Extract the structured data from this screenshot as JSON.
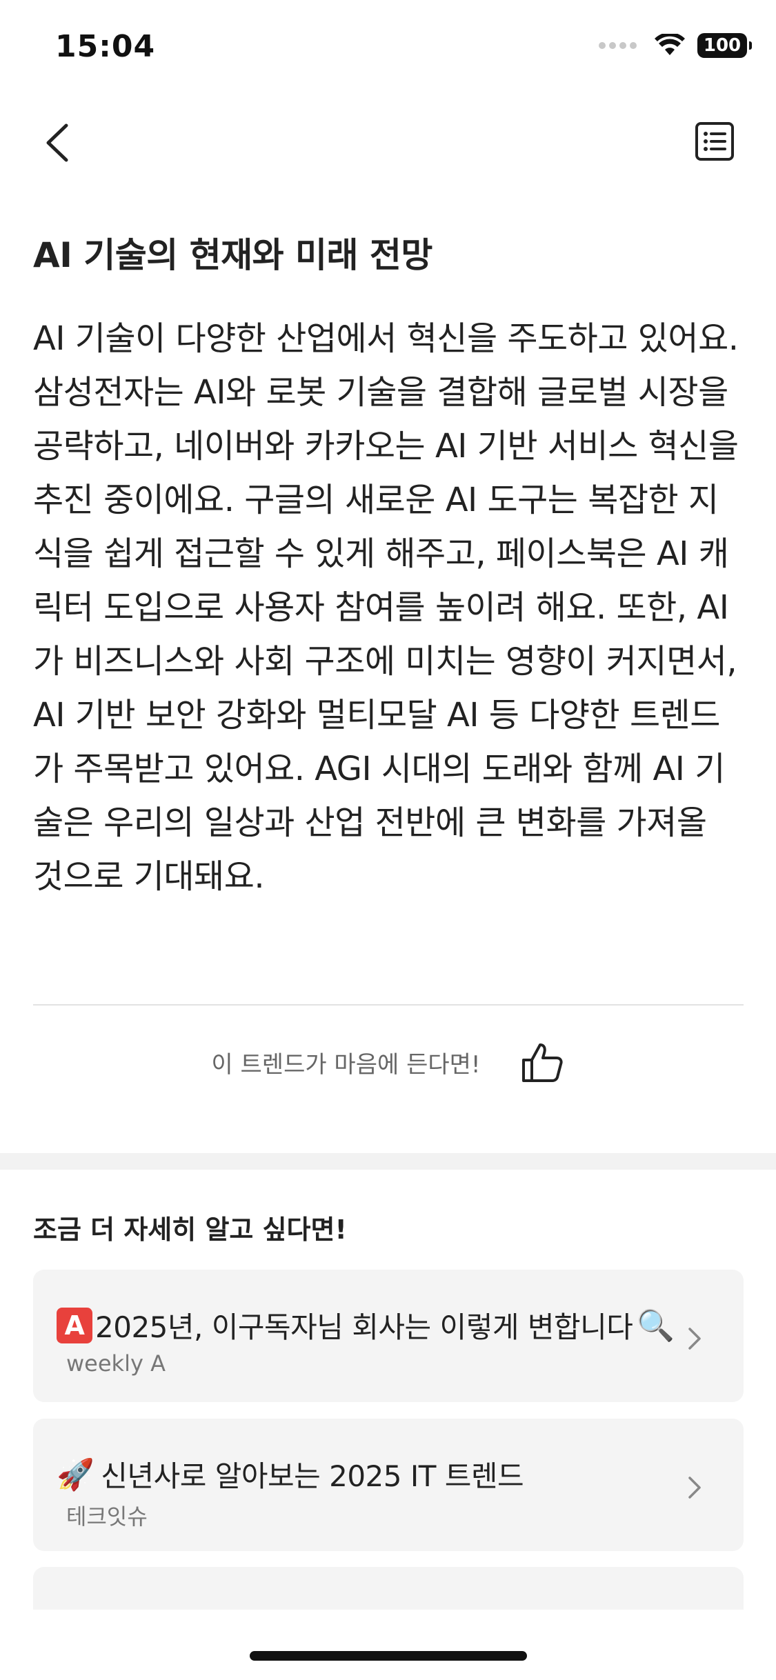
{
  "status_bar": {
    "time": "15:04",
    "battery": "100"
  },
  "article": {
    "title": "AI 기술의 현재와 미래 전망",
    "body": "AI 기술이 다양한 산업에서 혁신을 주도하고 있어요. 삼성전자는 AI와 로봇 기술을 결합해 글로벌 시장을 공략하고, 네이버와 카카오는 AI 기반 서비스 혁신을 추진 중이에요. 구글의 새로운 AI 도구는 복잡한 지식을 쉽게 접근할 수 있게 해주고, 페이스북은 AI 캐릭터 도입으로 사용자 참여를 높이려 해요. 또한, AI가 비즈니스와 사회 구조에 미치는 영향이 커지면서, AI 기반 보안 강화와 멀티모달 AI 등 다양한 트렌드가 주목받고 있어요. AGI 시대의 도래와 함께 AI 기술은 우리의 일상과 산업 전반에 큰 변화를 가져올 것으로 기대돼요."
  },
  "like": {
    "text": "이 트렌드가 마음에 든다면!"
  },
  "related": {
    "heading": "조금 더 자세히 알고 싶다면!",
    "items": [
      {
        "prefix": "A",
        "title": "2025년, 이구독자님 회사는 이렇게 변합니다",
        "suffix": "🔍",
        "source": "weekly A"
      },
      {
        "prefix": "🚀",
        "title": "신년사로 알아보는 2025 IT 트렌드",
        "source": "테크잇슈"
      }
    ]
  },
  "icons": {
    "back": "chevron-left-icon",
    "toc": "list-icon",
    "like": "thumbs-up-icon",
    "card_arrow": "chevron-right-icon"
  },
  "colors": {
    "accent_red": "#e8413c",
    "card_bg": "#f4f4f4",
    "muted_text": "#777777"
  }
}
